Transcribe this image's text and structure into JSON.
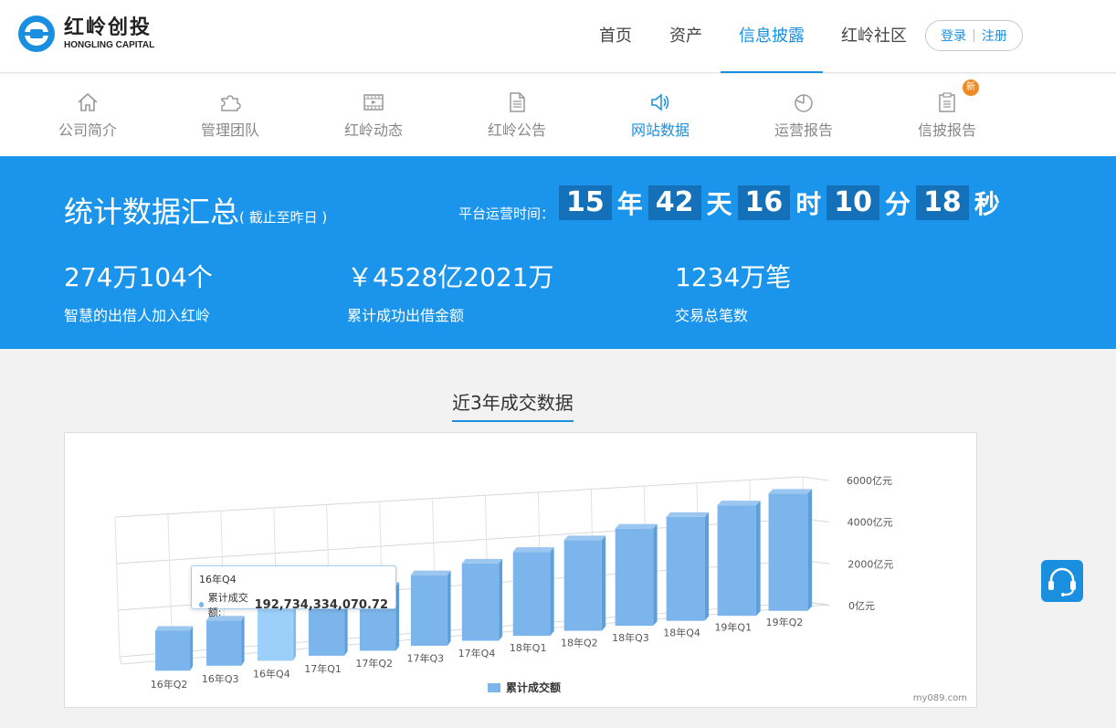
{
  "header": {
    "logo_cn": "红岭创投",
    "logo_en": "HONGLING CAPITAL",
    "nav": [
      {
        "label": "首页"
      },
      {
        "label": "资产"
      },
      {
        "label": "信息披露"
      },
      {
        "label": "红岭社区"
      }
    ],
    "login": "登录",
    "sep": "|",
    "register": "注册"
  },
  "subnav": {
    "items": [
      {
        "label": "公司简介",
        "icon": "home-icon"
      },
      {
        "label": "管理团队",
        "icon": "puzzle-icon"
      },
      {
        "label": "红岭动态",
        "icon": "video-icon"
      },
      {
        "label": "红岭公告",
        "icon": "document-icon"
      },
      {
        "label": "网站数据",
        "icon": "speaker-icon"
      },
      {
        "label": "运营报告",
        "icon": "pie-icon"
      },
      {
        "label": "信披报告",
        "icon": "clipboard-icon"
      }
    ],
    "new_badge": "新"
  },
  "banner": {
    "title": "统计数据汇总",
    "title_sub": "( 截止至昨日 )",
    "runtime_label": "平台运营时间：",
    "runtime": [
      {
        "value": "15",
        "unit": "年"
      },
      {
        "value": "42",
        "unit": "天"
      },
      {
        "value": "16",
        "unit": "时"
      },
      {
        "value": "10",
        "unit": "分"
      },
      {
        "value": "18",
        "unit": "秒"
      }
    ],
    "metrics": [
      {
        "value": "274万104个",
        "label": "智慧的出借人加入红岭"
      },
      {
        "value": "￥4528亿2021万",
        "label": "累计成功出借金额"
      },
      {
        "value": "1234万笔",
        "label": "交易总笔数"
      }
    ]
  },
  "section_title": "近3年成交数据",
  "chart_data": {
    "type": "bar",
    "categories": [
      "16年Q2",
      "16年Q3",
      "16年Q4",
      "17年Q1",
      "17年Q2",
      "17年Q3",
      "17年Q4",
      "18年Q1",
      "18年Q2",
      "18年Q3",
      "18年Q4",
      "19年Q1",
      "19年Q2"
    ],
    "series": [
      {
        "name": "累计成交额",
        "values": [
          1500,
          1700,
          1930,
          2150,
          2400,
          2650,
          2900,
          3150,
          3400,
          3650,
          3900,
          4150,
          4400
        ]
      }
    ],
    "yunit": "亿元",
    "yticks": [
      "0亿元",
      "2000亿元",
      "4000亿元",
      "6000亿元"
    ],
    "ylim": [
      0,
      6000
    ],
    "tooltip": {
      "category": "16年Q4",
      "series_label": "累计成交额:",
      "value": "192,734,334,070.72"
    },
    "legend": "累计成交额",
    "color": "#7cb5ec",
    "highlight_color": "#9ccffa"
  },
  "watermark": "my089.com",
  "colors": {
    "primary": "#1a8fe0",
    "banner": "#1b94ec",
    "badge": "#f08a24"
  }
}
